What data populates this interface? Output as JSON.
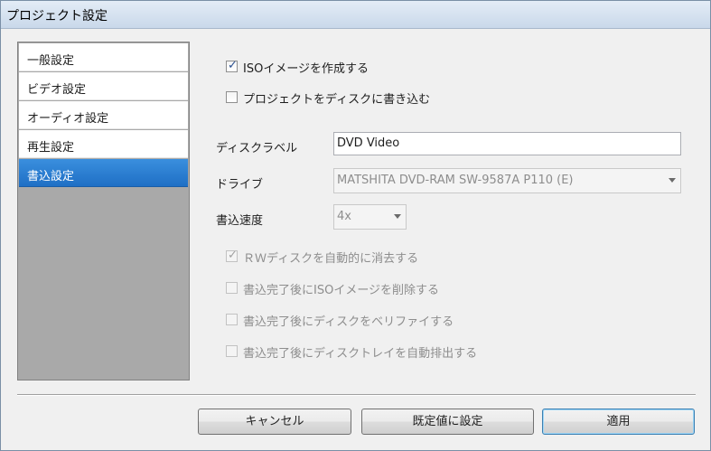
{
  "window": {
    "title": "プロジェクト設定"
  },
  "sidebar": {
    "items": [
      {
        "label": "一般設定",
        "selected": false
      },
      {
        "label": "ビデオ設定",
        "selected": false
      },
      {
        "label": "オーディオ設定",
        "selected": false
      },
      {
        "label": "再生設定",
        "selected": false
      },
      {
        "label": "書込設定",
        "selected": true
      }
    ]
  },
  "options": {
    "create_iso": {
      "label": "ISOイメージを作成する",
      "checked": true
    },
    "write_disc": {
      "label": "プロジェクトをディスクに書き込む",
      "checked": false
    }
  },
  "fields": {
    "disc_label": {
      "label": "ディスクラベル",
      "value": "DVD Video"
    },
    "drive": {
      "label": "ドライブ",
      "value": "MATSHITA DVD-RAM SW-9587A P110 (E)"
    },
    "speed": {
      "label": "書込速度",
      "value": "4x"
    }
  },
  "write_options": {
    "erase_rw": {
      "label": "ＲＷディスクを自動的に消去する",
      "checked": true,
      "enabled": false
    },
    "delete_iso": {
      "label": "書込完了後にISOイメージを削除する",
      "checked": false,
      "enabled": false
    },
    "verify": {
      "label": "書込完了後にディスクをベリファイする",
      "checked": false,
      "enabled": false
    },
    "eject": {
      "label": "書込完了後にディスクトレイを自動排出する",
      "checked": false,
      "enabled": false
    }
  },
  "buttons": {
    "cancel": "キャンセル",
    "defaults": "既定値に設定",
    "apply": "適用"
  },
  "colors": {
    "selection": "#2a7dd3",
    "sidebar_bg": "#a9a9a9",
    "disabled_text": "#8d8d8d"
  }
}
